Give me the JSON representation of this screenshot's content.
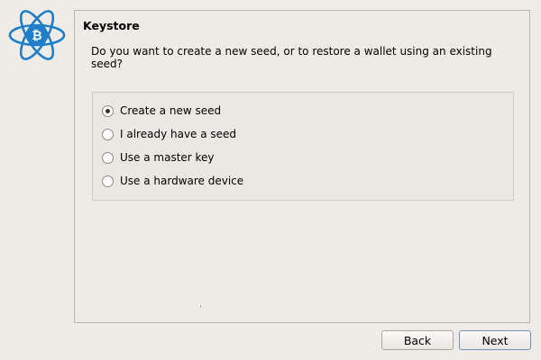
{
  "panel": {
    "title": "Keystore",
    "question": "Do you want to create a new seed, or to restore a wallet using an existing seed?"
  },
  "options": [
    {
      "label": "Create a new seed",
      "selected": true
    },
    {
      "label": "I already have a seed",
      "selected": false
    },
    {
      "label": "Use a master key",
      "selected": false
    },
    {
      "label": "Use a hardware device",
      "selected": false
    }
  ],
  "buttons": {
    "back": "Back",
    "next": "Next"
  },
  "logo": {
    "icon": "electrum-bitcoin-atom-logo",
    "color": "#1e7ec8"
  }
}
